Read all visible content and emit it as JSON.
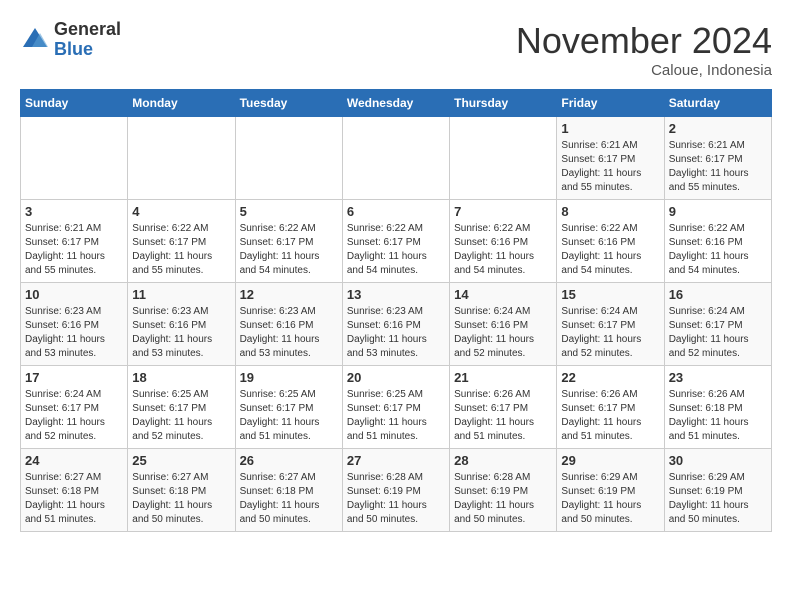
{
  "logo": {
    "general": "General",
    "blue": "Blue"
  },
  "title": "November 2024",
  "location": "Caloue, Indonesia",
  "days_of_week": [
    "Sunday",
    "Monday",
    "Tuesday",
    "Wednesday",
    "Thursday",
    "Friday",
    "Saturday"
  ],
  "weeks": [
    [
      {
        "day": "",
        "info": ""
      },
      {
        "day": "",
        "info": ""
      },
      {
        "day": "",
        "info": ""
      },
      {
        "day": "",
        "info": ""
      },
      {
        "day": "",
        "info": ""
      },
      {
        "day": "1",
        "info": "Sunrise: 6:21 AM\nSunset: 6:17 PM\nDaylight: 11 hours and 55 minutes."
      },
      {
        "day": "2",
        "info": "Sunrise: 6:21 AM\nSunset: 6:17 PM\nDaylight: 11 hours and 55 minutes."
      }
    ],
    [
      {
        "day": "3",
        "info": "Sunrise: 6:21 AM\nSunset: 6:17 PM\nDaylight: 11 hours and 55 minutes."
      },
      {
        "day": "4",
        "info": "Sunrise: 6:22 AM\nSunset: 6:17 PM\nDaylight: 11 hours and 55 minutes."
      },
      {
        "day": "5",
        "info": "Sunrise: 6:22 AM\nSunset: 6:17 PM\nDaylight: 11 hours and 54 minutes."
      },
      {
        "day": "6",
        "info": "Sunrise: 6:22 AM\nSunset: 6:17 PM\nDaylight: 11 hours and 54 minutes."
      },
      {
        "day": "7",
        "info": "Sunrise: 6:22 AM\nSunset: 6:16 PM\nDaylight: 11 hours and 54 minutes."
      },
      {
        "day": "8",
        "info": "Sunrise: 6:22 AM\nSunset: 6:16 PM\nDaylight: 11 hours and 54 minutes."
      },
      {
        "day": "9",
        "info": "Sunrise: 6:22 AM\nSunset: 6:16 PM\nDaylight: 11 hours and 54 minutes."
      }
    ],
    [
      {
        "day": "10",
        "info": "Sunrise: 6:23 AM\nSunset: 6:16 PM\nDaylight: 11 hours and 53 minutes."
      },
      {
        "day": "11",
        "info": "Sunrise: 6:23 AM\nSunset: 6:16 PM\nDaylight: 11 hours and 53 minutes."
      },
      {
        "day": "12",
        "info": "Sunrise: 6:23 AM\nSunset: 6:16 PM\nDaylight: 11 hours and 53 minutes."
      },
      {
        "day": "13",
        "info": "Sunrise: 6:23 AM\nSunset: 6:16 PM\nDaylight: 11 hours and 53 minutes."
      },
      {
        "day": "14",
        "info": "Sunrise: 6:24 AM\nSunset: 6:16 PM\nDaylight: 11 hours and 52 minutes."
      },
      {
        "day": "15",
        "info": "Sunrise: 6:24 AM\nSunset: 6:17 PM\nDaylight: 11 hours and 52 minutes."
      },
      {
        "day": "16",
        "info": "Sunrise: 6:24 AM\nSunset: 6:17 PM\nDaylight: 11 hours and 52 minutes."
      }
    ],
    [
      {
        "day": "17",
        "info": "Sunrise: 6:24 AM\nSunset: 6:17 PM\nDaylight: 11 hours and 52 minutes."
      },
      {
        "day": "18",
        "info": "Sunrise: 6:25 AM\nSunset: 6:17 PM\nDaylight: 11 hours and 52 minutes."
      },
      {
        "day": "19",
        "info": "Sunrise: 6:25 AM\nSunset: 6:17 PM\nDaylight: 11 hours and 51 minutes."
      },
      {
        "day": "20",
        "info": "Sunrise: 6:25 AM\nSunset: 6:17 PM\nDaylight: 11 hours and 51 minutes."
      },
      {
        "day": "21",
        "info": "Sunrise: 6:26 AM\nSunset: 6:17 PM\nDaylight: 11 hours and 51 minutes."
      },
      {
        "day": "22",
        "info": "Sunrise: 6:26 AM\nSunset: 6:17 PM\nDaylight: 11 hours and 51 minutes."
      },
      {
        "day": "23",
        "info": "Sunrise: 6:26 AM\nSunset: 6:18 PM\nDaylight: 11 hours and 51 minutes."
      }
    ],
    [
      {
        "day": "24",
        "info": "Sunrise: 6:27 AM\nSunset: 6:18 PM\nDaylight: 11 hours and 51 minutes."
      },
      {
        "day": "25",
        "info": "Sunrise: 6:27 AM\nSunset: 6:18 PM\nDaylight: 11 hours and 50 minutes."
      },
      {
        "day": "26",
        "info": "Sunrise: 6:27 AM\nSunset: 6:18 PM\nDaylight: 11 hours and 50 minutes."
      },
      {
        "day": "27",
        "info": "Sunrise: 6:28 AM\nSunset: 6:19 PM\nDaylight: 11 hours and 50 minutes."
      },
      {
        "day": "28",
        "info": "Sunrise: 6:28 AM\nSunset: 6:19 PM\nDaylight: 11 hours and 50 minutes."
      },
      {
        "day": "29",
        "info": "Sunrise: 6:29 AM\nSunset: 6:19 PM\nDaylight: 11 hours and 50 minutes."
      },
      {
        "day": "30",
        "info": "Sunrise: 6:29 AM\nSunset: 6:19 PM\nDaylight: 11 hours and 50 minutes."
      }
    ]
  ]
}
